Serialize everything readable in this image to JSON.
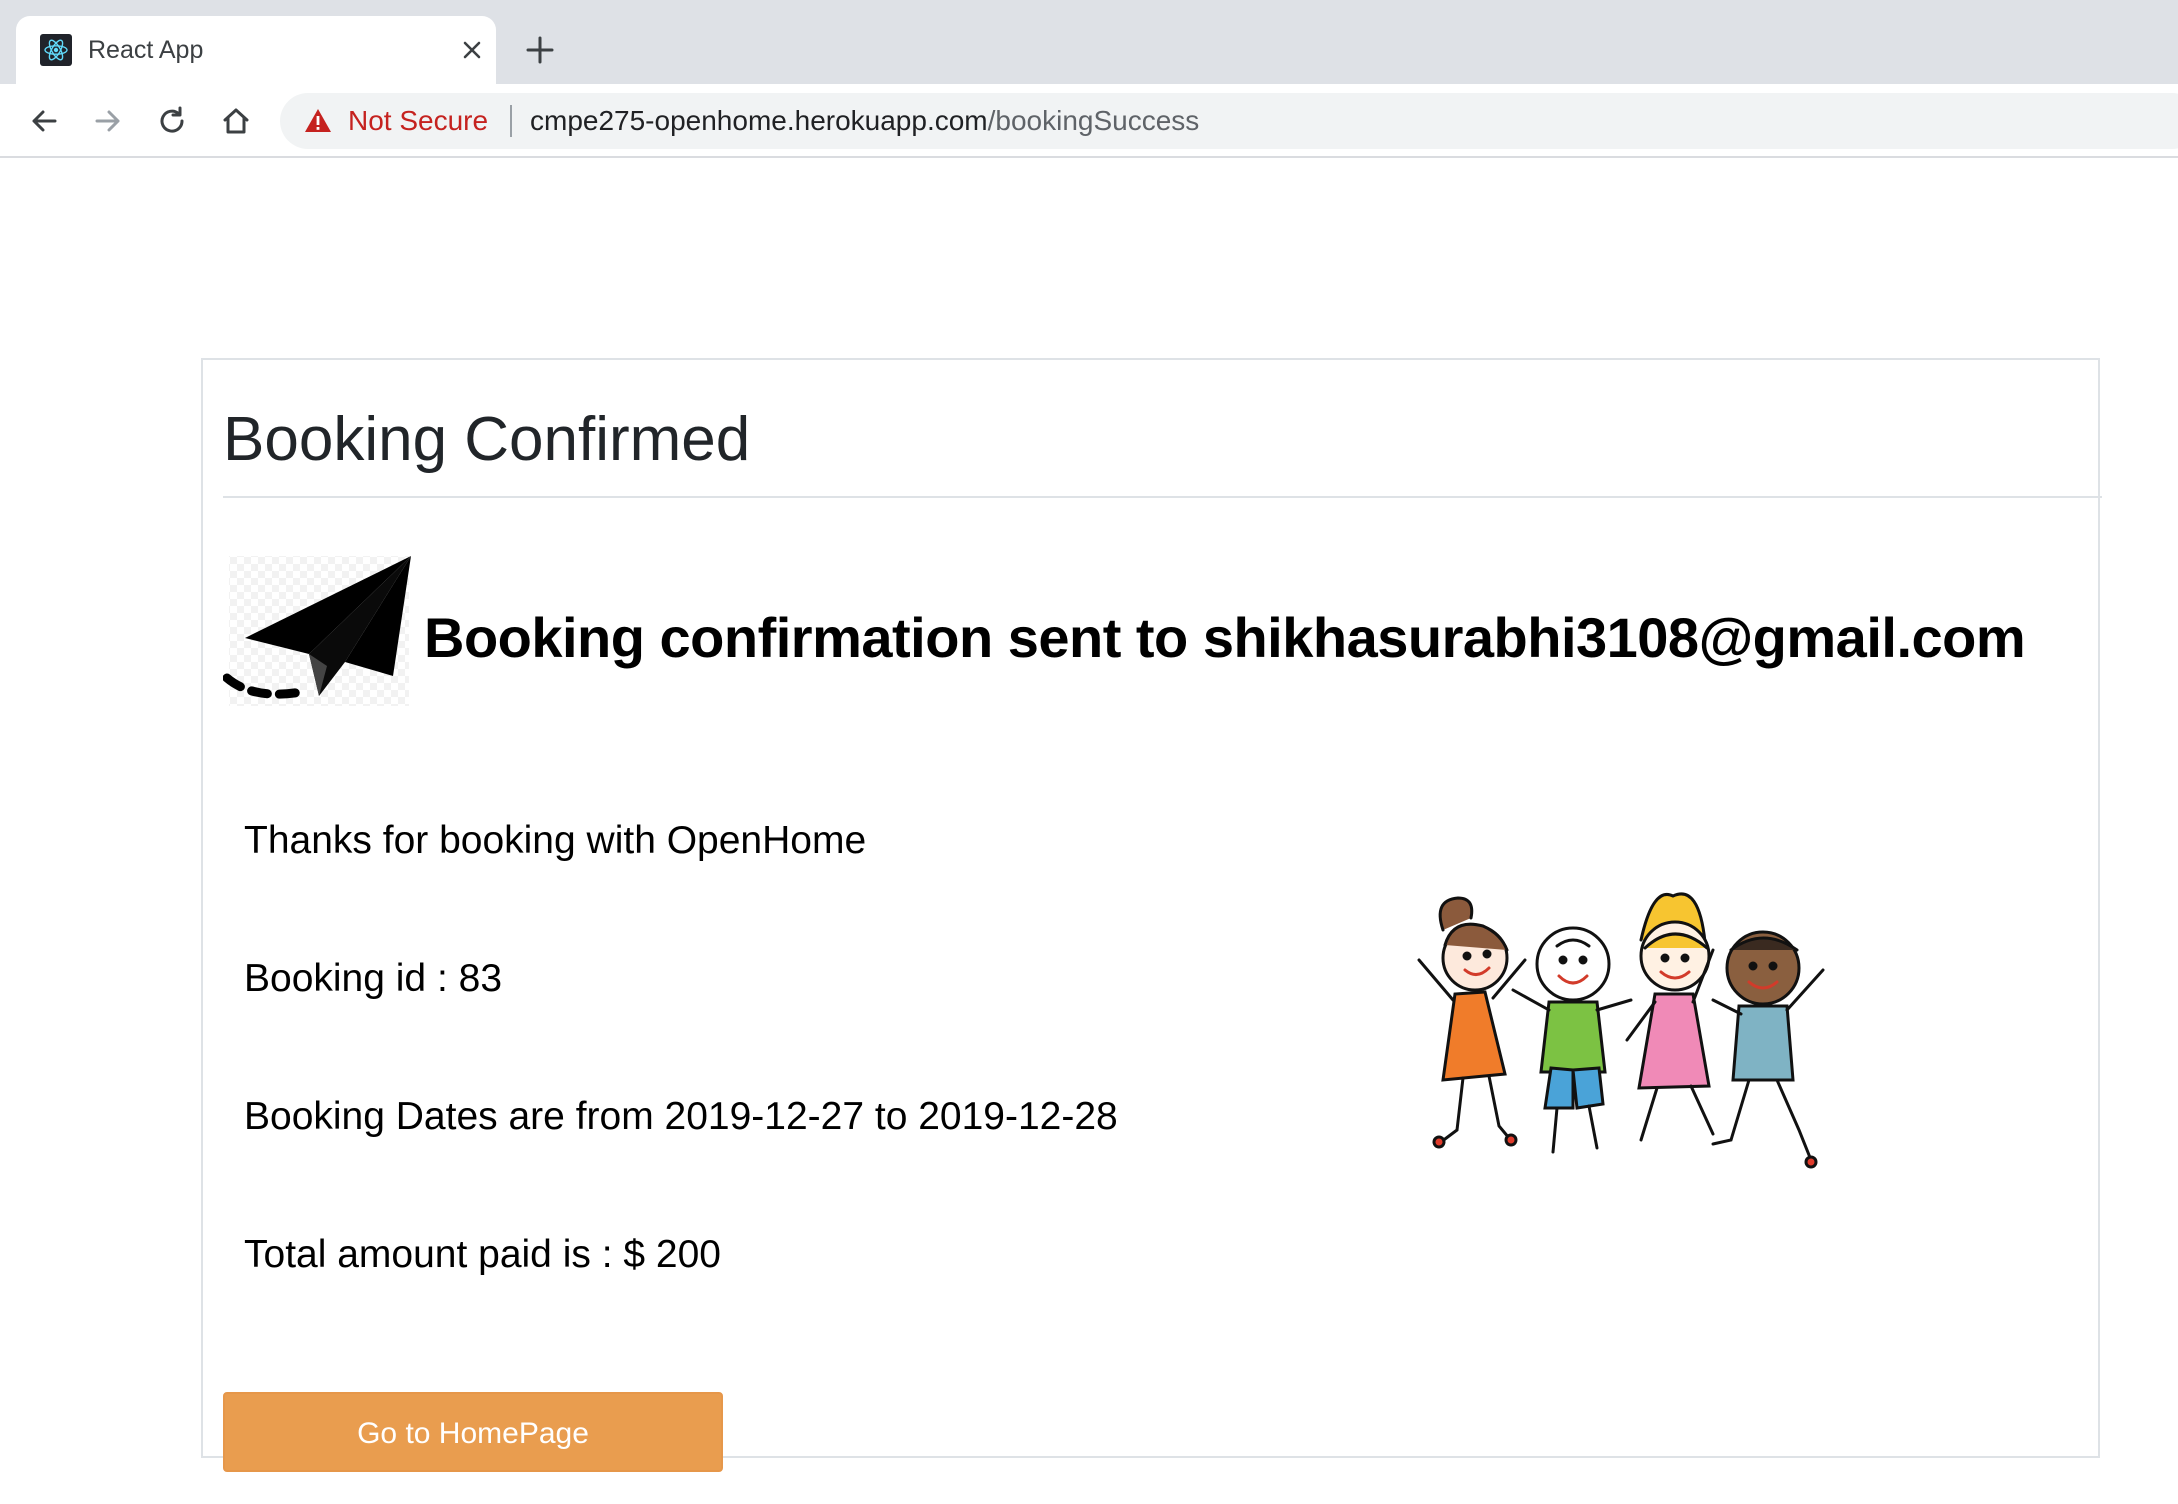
{
  "browser": {
    "tab_title": "React App",
    "security_label": "Not Secure",
    "url_host": "cmpe275-openhome.herokuapp.com",
    "url_path": "/bookingSuccess",
    "icons": [
      "react-favicon-icon",
      "close-icon",
      "plus-icon",
      "back-arrow-icon",
      "forward-arrow-icon",
      "reload-icon",
      "home-icon",
      "warning-icon"
    ],
    "colors": {
      "security_warning": "#c5221f",
      "tabstrip": "#dee1e6"
    }
  },
  "page": {
    "title": "Booking Confirmed",
    "confirmation_prefix": "Booking confirmation sent to ",
    "email": "shikhasurabhi3108@gmail.com",
    "thanks": "Thanks for booking with OpenHome",
    "booking_id_line": "Booking id : 83",
    "booking_dates_line": "Booking Dates are from 2019-12-27 to 2019-12-28",
    "amount_line": "Total amount paid is : $ 200",
    "home_button": "Go to HomePage",
    "icons": [
      "paper-plane-icon"
    ],
    "colors": {
      "button": "#e99d4f"
    }
  }
}
